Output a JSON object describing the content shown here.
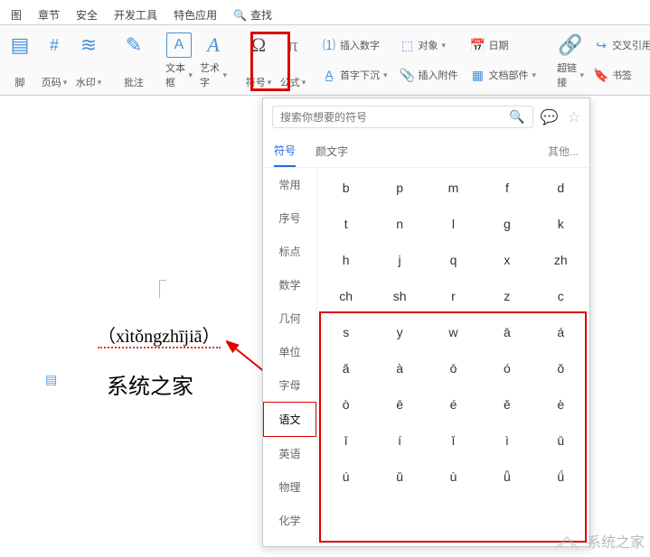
{
  "tabs": {
    "t1": "图",
    "t2": "章节",
    "t3": "安全",
    "t4": "开发工具",
    "t5": "特色应用",
    "t6": "查找"
  },
  "ribbon": {
    "footer_lbl": "脚",
    "pagenum_lbl": "页码",
    "watermark_lbl": "水印",
    "comment_lbl": "批注",
    "textbox_lbl": "文本框",
    "wordart_lbl": "艺术字",
    "symbol_lbl": "符号",
    "equation_lbl": "公式",
    "insnum": "插入数字",
    "object": "对象",
    "date": "日期",
    "dropcap": "首字下沉",
    "attach": "插入附件",
    "docparts": "文档部件",
    "hyperlink": "超链接",
    "crossref": "交叉引用",
    "bookmark": "书签"
  },
  "doc": {
    "pinyin": "（xìtǒngzhījiā）",
    "text": "系统之家"
  },
  "popup": {
    "search_ph": "搜索你想要的符号",
    "tab_sym": "符号",
    "tab_emoji": "颜文字",
    "tab_other": "其他..."
  },
  "categories": [
    "常用",
    "序号",
    "标点",
    "数学",
    "几何",
    "单位",
    "字母",
    "语文",
    "英语",
    "物理",
    "化学"
  ],
  "cat_selected_index": 7,
  "symbols": [
    "b",
    "p",
    "m",
    "f",
    "d",
    "t",
    "n",
    "l",
    "g",
    "k",
    "h",
    "j",
    "q",
    "x",
    "zh",
    "ch",
    "sh",
    "r",
    "z",
    "c",
    "s",
    "y",
    "w",
    "ā",
    "á",
    "ǎ",
    "à",
    "ō",
    "ó",
    "ǒ",
    "ò",
    "ē",
    "é",
    "ě",
    "è",
    "ī",
    "í",
    "ǐ",
    "ì",
    "ū",
    "ú",
    "ǔ",
    "ù",
    "ǖ",
    "ǘ"
  ],
  "watermark_text": "系统之家"
}
